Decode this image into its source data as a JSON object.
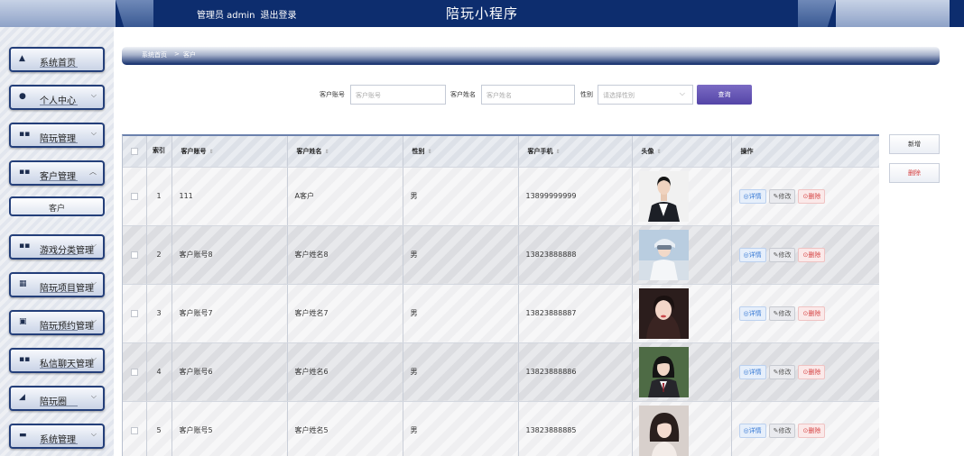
{
  "header": {
    "user_label": "管理员 admin",
    "logout_label": "退出登录",
    "app_title": "陪玩小程序"
  },
  "sidebar": {
    "items": [
      {
        "label": "系统首页",
        "icon": "home-icon",
        "glyph": "▲"
      },
      {
        "label": "个人中心",
        "icon": "user-icon",
        "glyph": "●"
      },
      {
        "label": "陪玩管理",
        "icon": "grid-icon",
        "glyph": "▪▪"
      },
      {
        "label": "客户管理",
        "icon": "grid-icon",
        "glyph": "▪▪"
      },
      {
        "label": "游戏分类管理",
        "icon": "grid-icon",
        "glyph": "▪▪"
      },
      {
        "label": "陪玩项目管理",
        "icon": "table-icon",
        "glyph": "▦"
      },
      {
        "label": "陪玩预约管理",
        "icon": "calendar-icon",
        "glyph": "▣"
      },
      {
        "label": "私信聊天管理",
        "icon": "grid-icon",
        "glyph": "▪▪"
      },
      {
        "label": "陪玩圈",
        "icon": "thumb-icon",
        "glyph": "◢"
      },
      {
        "label": "系统管理",
        "icon": "settings-icon",
        "glyph": "▬"
      }
    ],
    "active_sub": "客户"
  },
  "breadcrumb": {
    "home": "系统首页",
    "separator": ">",
    "current": "客户"
  },
  "search": {
    "account_label": "客户账号",
    "account_placeholder": "客户账号",
    "name_label": "客户姓名",
    "name_placeholder": "客户姓名",
    "gender_label": "性别",
    "gender_placeholder": "请选择性别",
    "query_button": "查询"
  },
  "actions": {
    "add_label": "新增",
    "delete_label": "删除"
  },
  "table": {
    "columns": {
      "index": "索引",
      "account": "客户账号",
      "name": "客户姓名",
      "gender": "性别",
      "phone": "客户手机",
      "avatar": "头像",
      "ops": "操作"
    },
    "detail_label": "◎详情",
    "edit_label": "✎修改",
    "delete_label": "⊙删除",
    "rows": [
      {
        "index": "1",
        "account": "111",
        "name": "A客户",
        "gender": "男",
        "phone": "13899999999"
      },
      {
        "index": "2",
        "account": "客户账号8",
        "name": "客户姓名8",
        "gender": "男",
        "phone": "13823888888"
      },
      {
        "index": "3",
        "account": "客户账号7",
        "name": "客户姓名7",
        "gender": "男",
        "phone": "13823888887"
      },
      {
        "index": "4",
        "account": "客户账号6",
        "name": "客户姓名6",
        "gender": "男",
        "phone": "13823888886"
      },
      {
        "index": "5",
        "account": "客户账号5",
        "name": "客户姓名5",
        "gender": "男",
        "phone": "13823888885"
      }
    ]
  },
  "colors": {
    "header_bg": "#0d2d6e",
    "menu_border": "#243f7a",
    "query_button": "#5f50b0",
    "delete_red": "#d43c3c"
  }
}
